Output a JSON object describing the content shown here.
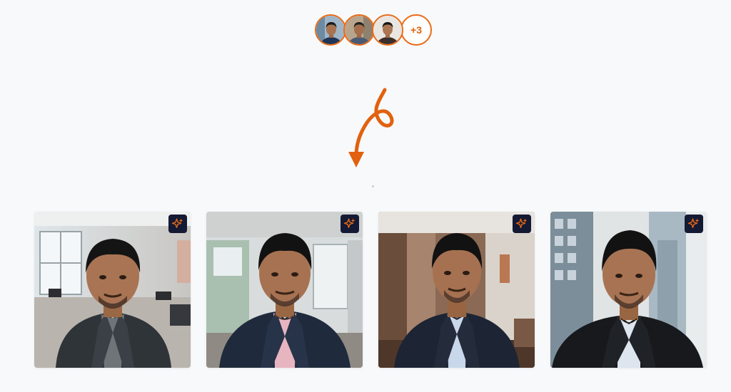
{
  "avatar_stack": {
    "more_count_label": "+3",
    "ring_color": "#ea6a16"
  },
  "arrow": {
    "color": "#e2610f"
  },
  "photos": [
    {
      "scene": "office-daylight",
      "badge_icon": "sparkle-icon"
    },
    {
      "scene": "office-window",
      "badge_icon": "sparkle-icon"
    },
    {
      "scene": "conference-room",
      "badge_icon": "sparkle-icon"
    },
    {
      "scene": "city-window",
      "badge_icon": "sparkle-icon"
    }
  ],
  "colors": {
    "accent": "#ea6a16",
    "badge_bg": "#141a33",
    "background": "#f8f9fb"
  }
}
